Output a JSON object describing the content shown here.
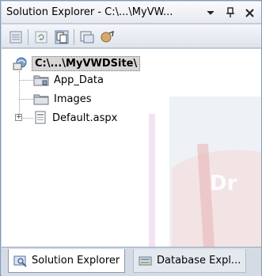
{
  "window": {
    "title": "Solution Explorer - C:\\...\\MyVW...",
    "buttons": {
      "dropdown": "▾",
      "pin": "ᴨ",
      "close": "✕"
    }
  },
  "toolbar": {
    "icons": [
      "properties-icon",
      "refresh-icon",
      "show-all-files-icon",
      "view-designer-icon",
      "nest-related-files-icon"
    ]
  },
  "tree": {
    "root": {
      "label": "C:\\...\\MyVWDSite\\",
      "icon": "website-icon"
    },
    "items": [
      {
        "label": "App_Data",
        "icon": "folder-icon"
      },
      {
        "label": "Images",
        "icon": "folder-icon"
      },
      {
        "label": "Default.aspx",
        "icon": "aspx-file-icon",
        "expandable": true
      }
    ]
  },
  "tabs": [
    {
      "label": "Solution Explorer",
      "active": true,
      "icon": "solution-explorer-icon"
    },
    {
      "label": "Database Expl...",
      "active": false,
      "icon": "database-explorer-icon"
    }
  ],
  "colors": {
    "frame": "#7f9db9",
    "accent": "#3a6ea5"
  }
}
